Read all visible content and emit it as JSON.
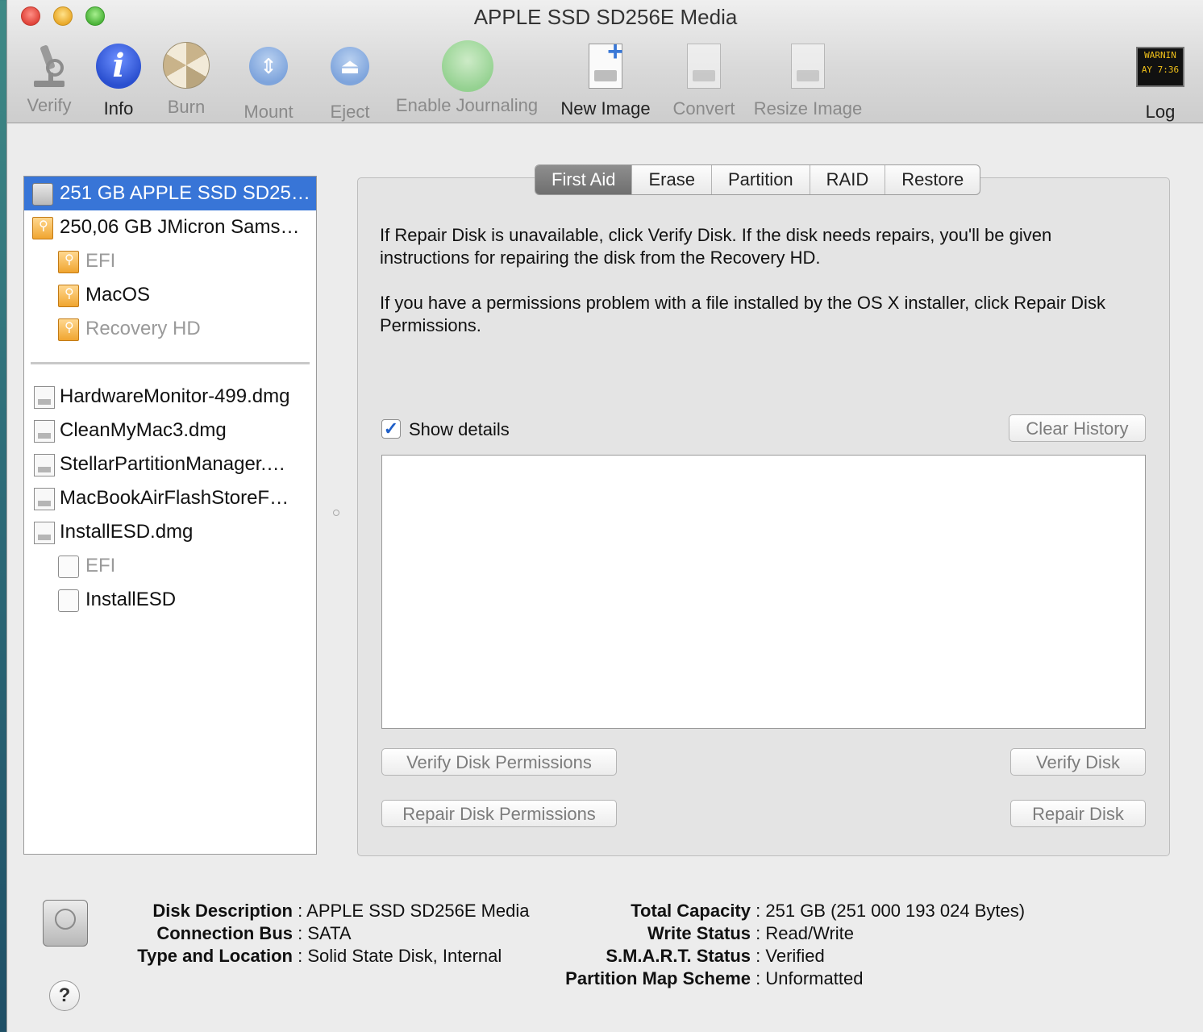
{
  "window": {
    "title": "APPLE SSD SD256E Media"
  },
  "toolbar": {
    "verify": "Verify",
    "info": "Info",
    "burn": "Burn",
    "mount": "Mount",
    "eject": "Eject",
    "enable_journaling": "Enable Journaling",
    "new_image": "New Image",
    "convert": "Convert",
    "resize_image": "Resize Image",
    "log": "Log",
    "log_display": [
      "WARNIN",
      "AY 7:36"
    ]
  },
  "sidebar": {
    "items": [
      {
        "label": "251 GB APPLE SSD SD25…",
        "icon": "internal-disk-icon",
        "selected": true
      },
      {
        "label": "250,06 GB JMicron Sams…",
        "icon": "usb-disk-icon"
      },
      {
        "label": "EFI",
        "icon": "usb-volume-icon",
        "dimmed": true
      },
      {
        "label": "MacOS",
        "icon": "usb-volume-icon"
      },
      {
        "label": "Recovery HD",
        "icon": "usb-volume-icon",
        "dimmed": true
      },
      {
        "label": "HardwareMonitor-499.dmg",
        "icon": "disk-image-icon"
      },
      {
        "label": "CleanMyMac3.dmg",
        "icon": "disk-image-icon"
      },
      {
        "label": "StellarPartitionManager.…",
        "icon": "disk-image-icon"
      },
      {
        "label": "MacBookAirFlashStoreF…",
        "icon": "disk-image-icon"
      },
      {
        "label": "InstallESD.dmg",
        "icon": "disk-image-icon"
      },
      {
        "label": "EFI",
        "icon": "volume-icon",
        "dimmed": true
      },
      {
        "label": "InstallESD",
        "icon": "volume-icon"
      }
    ]
  },
  "tabs": [
    "First Aid",
    "Erase",
    "Partition",
    "RAID",
    "Restore"
  ],
  "first_aid": {
    "para1": "If Repair Disk is unavailable, click Verify Disk. If the disk needs repairs, you'll be given instructions for repairing the disk from the Recovery HD.",
    "para2": "If you have a permissions problem with a file installed by the OS X installer, click Repair Disk Permissions.",
    "show_details_label": "Show details",
    "show_details_checked": true,
    "clear_history": "Clear History",
    "verify_permissions": "Verify Disk Permissions",
    "repair_permissions": "Repair Disk Permissions",
    "verify_disk": "Verify Disk",
    "repair_disk": "Repair Disk"
  },
  "disk_info": {
    "description_label": "Disk Description",
    "description_value": "APPLE SSD SD256E Media",
    "bus_label": "Connection Bus",
    "bus_value": "SATA",
    "type_label": "Type and Location",
    "type_value": "Solid State Disk, Internal",
    "capacity_label": "Total Capacity",
    "capacity_value": "251 GB (251 000 193 024 Bytes)",
    "write_label": "Write Status",
    "write_value": "Read/Write",
    "smart_label": "S.M.A.R.T. Status",
    "smart_value": "Verified",
    "scheme_label": "Partition Map Scheme",
    "scheme_value": "Unformatted",
    "separator": ":"
  }
}
